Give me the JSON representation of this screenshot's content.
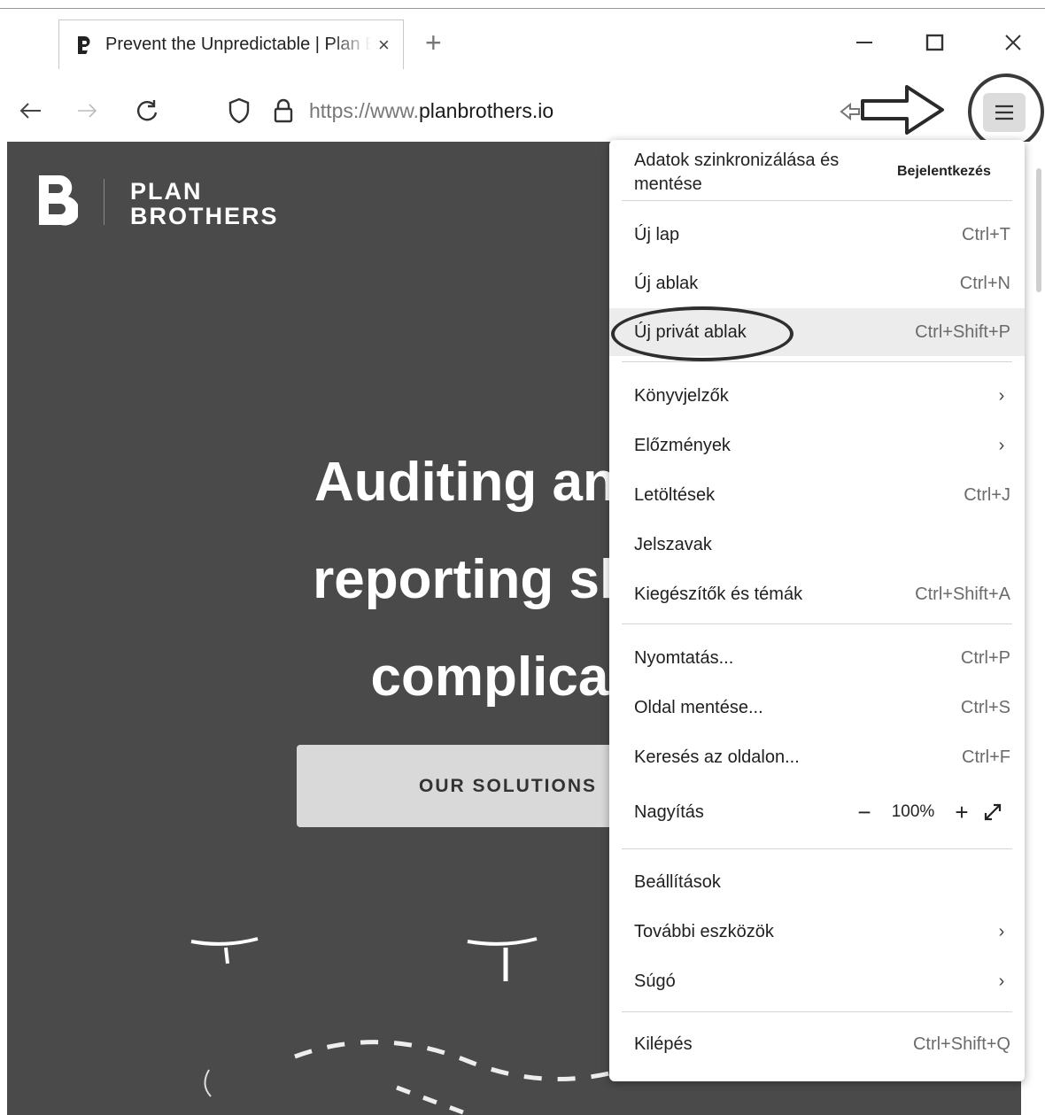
{
  "tab": {
    "title": "Prevent the Unpredictable | Plan Brothers",
    "close_glyph": "×"
  },
  "new_tab_glyph": "+",
  "address_bar": {
    "url_prefix": "https://www.",
    "url_host": "planbrothers.io"
  },
  "site": {
    "logo_line1": "PLAN",
    "logo_line2": "BROTHERS",
    "hero_line1": "Auditing and in",
    "hero_line2": "reporting shoul",
    "hero_line3": "complicate",
    "cta": "OUR SOLUTIONS"
  },
  "menu": {
    "header": "Adatok szinkronizálása és mentése",
    "sign_in": "Bejelentkezés",
    "items": [
      {
        "label": "Új lap",
        "shortcut": "Ctrl+T"
      },
      {
        "label": "Új ablak",
        "shortcut": "Ctrl+N"
      },
      {
        "label": "Új privát ablak",
        "shortcut": "Ctrl+Shift+P"
      },
      {
        "label": "Könyvjelzők",
        "chevron": "›"
      },
      {
        "label": "Előzmények",
        "chevron": "›"
      },
      {
        "label": "Letöltések",
        "shortcut": "Ctrl+J"
      },
      {
        "label": "Jelszavak"
      },
      {
        "label": "Kiegészítők és témák",
        "shortcut": "Ctrl+Shift+A"
      },
      {
        "label": "Nyomtatás...",
        "shortcut": "Ctrl+P"
      },
      {
        "label": "Oldal mentése...",
        "shortcut": "Ctrl+S"
      },
      {
        "label": "Keresés az oldalon...",
        "shortcut": "Ctrl+F"
      },
      {
        "label": "Nagyítás"
      },
      {
        "label": "Beállítások"
      },
      {
        "label": "További eszközök",
        "chevron": "›"
      },
      {
        "label": "Súgó",
        "chevron": "›"
      },
      {
        "label": "Kilépés",
        "shortcut": "Ctrl+Shift+Q"
      }
    ],
    "zoom": {
      "minus": "−",
      "value": "100%",
      "plus": "+"
    }
  },
  "icons": {
    "back": "back-arrow-icon",
    "forward": "forward-arrow-icon",
    "reload": "reload-icon",
    "shield": "tracking-protection-shield-icon",
    "lock": "lock-icon",
    "star": "bookmark-star-icon",
    "menu": "hamburger-menu-icon",
    "fullscreen": "fullscreen-icon"
  },
  "colors": {
    "page_background": "#4a4a4a",
    "cta_background": "#d9d9d9",
    "highlight_row": "#ececec"
  }
}
